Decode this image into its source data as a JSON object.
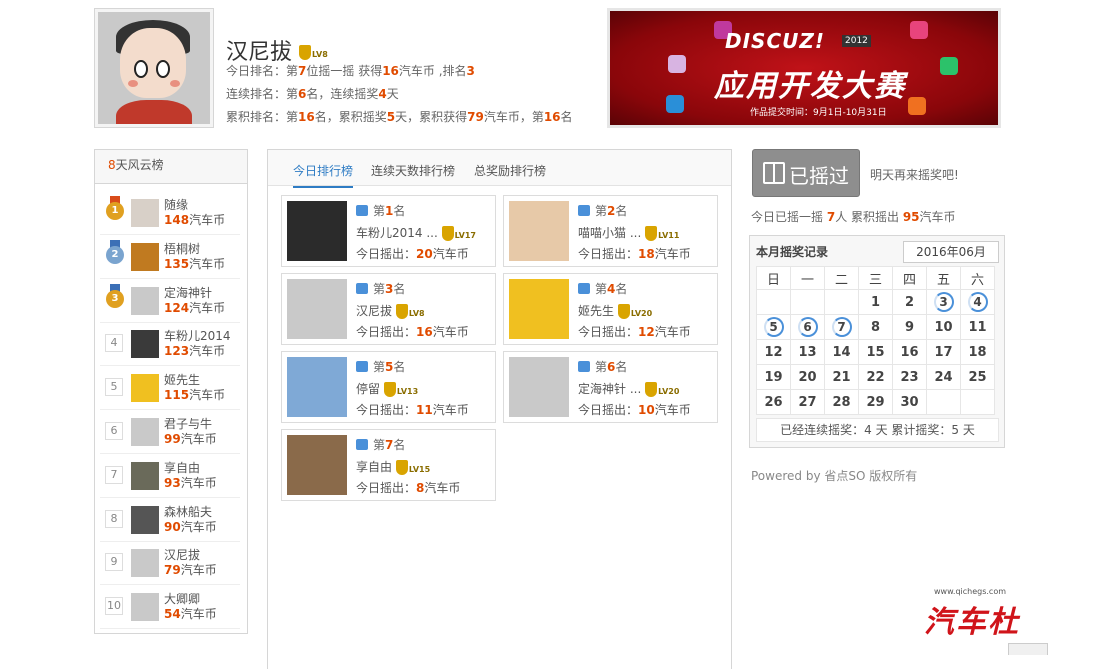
{
  "user": {
    "name": "汉尼拔",
    "level": "LV8",
    "today_prefix": "今日排名：第",
    "today_rank": "7",
    "today_mid": "位摇一摇 获得",
    "today_coins": "16",
    "today_suffix": "汽车币 ,排名",
    "today_rank2": "3",
    "streak_prefix": "连续排名：第",
    "streak_rank": "6",
    "streak_mid": "名，连续摇奖",
    "streak_days": "4",
    "streak_suffix": "天",
    "total_prefix": "累积排名：第",
    "total_rank": "16",
    "total_mid1": "名，累积摇奖",
    "total_days": "5",
    "total_mid2": "天，累积获得",
    "total_coins": "79",
    "total_mid3": "汽车币，第",
    "total_rank2": "16",
    "total_suffix": "名"
  },
  "banner": {
    "logo": "DISCUZ!",
    "year": "2012",
    "title": "应用开发大赛",
    "subtitle": "作品提交时间：9月1日-10月31日"
  },
  "left": {
    "title_num": "8",
    "title": "天风云榜",
    "unit": "汽车币",
    "items": [
      {
        "rank": "1",
        "name": "随缘",
        "coins": "148"
      },
      {
        "rank": "2",
        "name": "梧桐树",
        "coins": "135"
      },
      {
        "rank": "3",
        "name": "定海神针",
        "coins": "124"
      },
      {
        "rank": "4",
        "name": "车粉儿2014",
        "coins": "123"
      },
      {
        "rank": "5",
        "name": "姬先生",
        "coins": "115"
      },
      {
        "rank": "6",
        "name": "君子与牛",
        "coins": "99"
      },
      {
        "rank": "7",
        "name": "享自由",
        "coins": "93"
      },
      {
        "rank": "8",
        "name": "森林船夫",
        "coins": "90"
      },
      {
        "rank": "9",
        "name": "汉尼拔",
        "coins": "79"
      },
      {
        "rank": "10",
        "name": "大卿卿",
        "coins": "54"
      }
    ]
  },
  "tabs": [
    "今日排行榜",
    "连续天数排行榜",
    "总奖励排行榜"
  ],
  "cards_text": {
    "rank_prefix": "第",
    "rank_suffix": "名",
    "shake_prefix": "今日摇出：",
    "unit": "汽车币"
  },
  "cards": [
    {
      "rank": "1",
      "name": "车粉儿2014 ...",
      "level": "LV17",
      "coins": "20"
    },
    {
      "rank": "2",
      "name": "喵喵小猫 ...",
      "level": "LV11",
      "coins": "18"
    },
    {
      "rank": "3",
      "name": "汉尼拔",
      "level": "LV8",
      "coins": "16"
    },
    {
      "rank": "4",
      "name": "姬先生",
      "level": "LV20",
      "coins": "12"
    },
    {
      "rank": "5",
      "name": "停留",
      "level": "LV13",
      "coins": "11"
    },
    {
      "rank": "6",
      "name": "定海神针 ...",
      "level": "LV20",
      "coins": "10"
    },
    {
      "rank": "7",
      "name": "享自由",
      "level": "LV15",
      "coins": "8"
    }
  ],
  "right": {
    "shake_button": "已摇过",
    "tomorrow": "明天再来摇奖吧!",
    "stat_prefix": "今日已摇一摇 ",
    "stat_people": "7",
    "stat_mid": "人 累积摇出 ",
    "stat_coins": "95",
    "stat_suffix": "汽车币"
  },
  "calendar": {
    "title": "本月摇奖记录",
    "month": "2016年06月",
    "weekdays": [
      "日",
      "一",
      "二",
      "三",
      "四",
      "五",
      "六"
    ],
    "rows": [
      [
        "",
        "",
        "",
        "1",
        "2",
        "3",
        "4"
      ],
      [
        "5",
        "6",
        "7",
        "8",
        "9",
        "10",
        "11"
      ],
      [
        "12",
        "13",
        "14",
        "15",
        "16",
        "17",
        "18"
      ],
      [
        "19",
        "20",
        "21",
        "22",
        "23",
        "24",
        "25"
      ],
      [
        "26",
        "27",
        "28",
        "29",
        "30",
        "",
        ""
      ]
    ],
    "marked": [
      "3",
      "4",
      "5",
      "6",
      "7"
    ],
    "footer": "已经连续摇奖：4 天 累计摇奖：5 天"
  },
  "footer": {
    "powered": "Powered by 省点SO 版权所有",
    "logo_url": "www.qichegs.com",
    "logo_text": "汽车杜"
  },
  "colors": {
    "accent": "#e04b00",
    "link": "#2e7cc4",
    "banner": "#b0101a"
  }
}
